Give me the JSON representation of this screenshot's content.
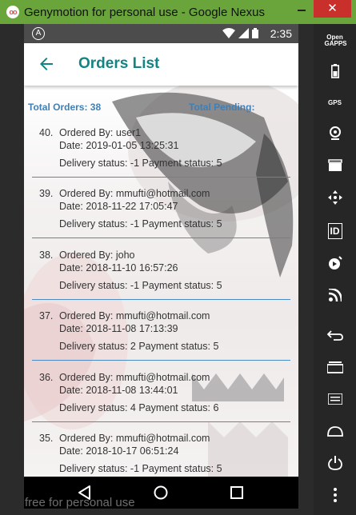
{
  "window": {
    "title": "Genymotion for personal use - Google Nexus",
    "close_label": "✕",
    "watermark": "free for personal use"
  },
  "statusbar": {
    "notif_icon_label": "A",
    "time": "2:35"
  },
  "appbar": {
    "title": "Orders List"
  },
  "summary": {
    "total_orders": "Total Orders: 38",
    "total_pending": "Total Pending:"
  },
  "orders": [
    {
      "num": "40.",
      "by": "Ordered By: user1",
      "date": "Date: 2019-01-05 13:25:31",
      "status": "Delivery status: -1 Payment status: 5"
    },
    {
      "num": "39.",
      "by": "Ordered By: mmufti@hotmail.com",
      "date": "Date: 2018-11-22 17:05:47",
      "status": "Delivery status: -1 Payment status: 5"
    },
    {
      "num": "38.",
      "by": "Ordered By: joho",
      "date": "Date: 2018-11-10 16:57:26",
      "status": "Delivery status: -1 Payment status: 5"
    },
    {
      "num": "37.",
      "by": "Ordered By: mmufti@hotmail.com",
      "date": "Date: 2018-11-08 17:13:39",
      "status": "Delivery status: 2 Payment status: 5"
    },
    {
      "num": "36.",
      "by": "Ordered By: mmufti@hotmail.com",
      "date": "Date: 2018-11-08 13:44:01",
      "status": "Delivery status: 4 Payment status: 6"
    },
    {
      "num": "35.",
      "by": "Ordered By: mmufti@hotmail.com",
      "date": "Date: 2018-10-17 06:51:24",
      "status": "Delivery status: -1 Payment status: 5"
    }
  ],
  "sidebar": {
    "tools": [
      {
        "name": "open-gapps-icon",
        "label": "Open GAPPS"
      },
      {
        "name": "battery-icon",
        "label": ""
      },
      {
        "name": "gps-icon",
        "label": "GPS"
      },
      {
        "name": "webcam-icon",
        "label": ""
      },
      {
        "name": "capture-icon",
        "label": ""
      },
      {
        "name": "move-icon",
        "label": ""
      },
      {
        "name": "identifiers-icon",
        "label": "ID"
      },
      {
        "name": "media-icon",
        "label": ""
      },
      {
        "name": "network-icon",
        "label": ""
      },
      {
        "name": "back-icon",
        "label": ""
      },
      {
        "name": "recent-apps-icon",
        "label": ""
      },
      {
        "name": "menu-icon",
        "label": ""
      },
      {
        "name": "home-icon",
        "label": ""
      },
      {
        "name": "power-icon",
        "label": ""
      },
      {
        "name": "more-icon",
        "label": ""
      }
    ]
  },
  "colors": {
    "titlebar": "#6aa53c",
    "accent": "#138484",
    "summary": "#3f7fb5",
    "separator": "#4a8bc4"
  }
}
